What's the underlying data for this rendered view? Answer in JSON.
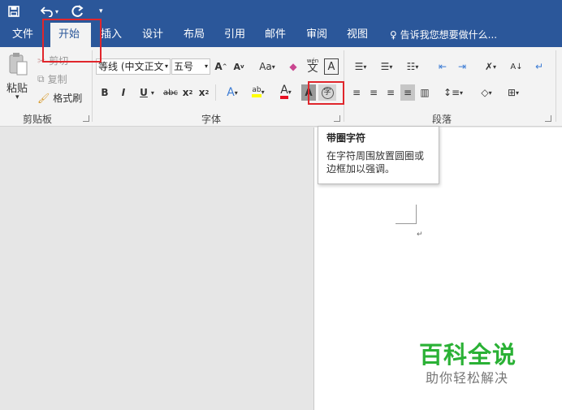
{
  "quick_access": {
    "save_icon": "save-icon",
    "undo_icon": "undo-icon",
    "redo_icon": "redo-icon"
  },
  "tabs": [
    {
      "label": "文件"
    },
    {
      "label": "开始"
    },
    {
      "label": "插入"
    },
    {
      "label": "设计"
    },
    {
      "label": "布局"
    },
    {
      "label": "引用"
    },
    {
      "label": "邮件"
    },
    {
      "label": "审阅"
    },
    {
      "label": "视图"
    }
  ],
  "tell_me": "告诉我您想要做什么...",
  "clipboard": {
    "paste_label": "粘贴",
    "cut_label": "剪切",
    "copy_label": "复制",
    "format_painter_label": "格式刷",
    "group_label": "剪贴板"
  },
  "font": {
    "font_name": "等线 (中文正文",
    "font_size": "五号",
    "group_label": "字体",
    "grow_label": "A",
    "shrink_label": "A",
    "case_label": "Aa",
    "phonetic_top": "wén",
    "phonetic_char": "文",
    "border_label": "A",
    "bold": "B",
    "italic": "I",
    "underline": "U",
    "strike": "abc",
    "subscript": "x",
    "superscript": "x",
    "effects": "A",
    "highlight": "ab",
    "font_color": "A",
    "shading": "A",
    "enclose_char": "字"
  },
  "paragraph": {
    "group_label": "段落",
    "sort_label": "A"
  },
  "tooltip": {
    "title": "带圈字符",
    "description": "在字符周围放置圆圈或边框加以强调。"
  },
  "watermark": {
    "title": "百科全说",
    "subtitle": "助你轻松解决"
  },
  "colors": {
    "ribbon_blue": "#2b579a",
    "highlight_red": "#e0262c",
    "watermark_green": "#2ab135",
    "font_color_red": "#e81123",
    "highlight_yellow": "#ffff00"
  }
}
